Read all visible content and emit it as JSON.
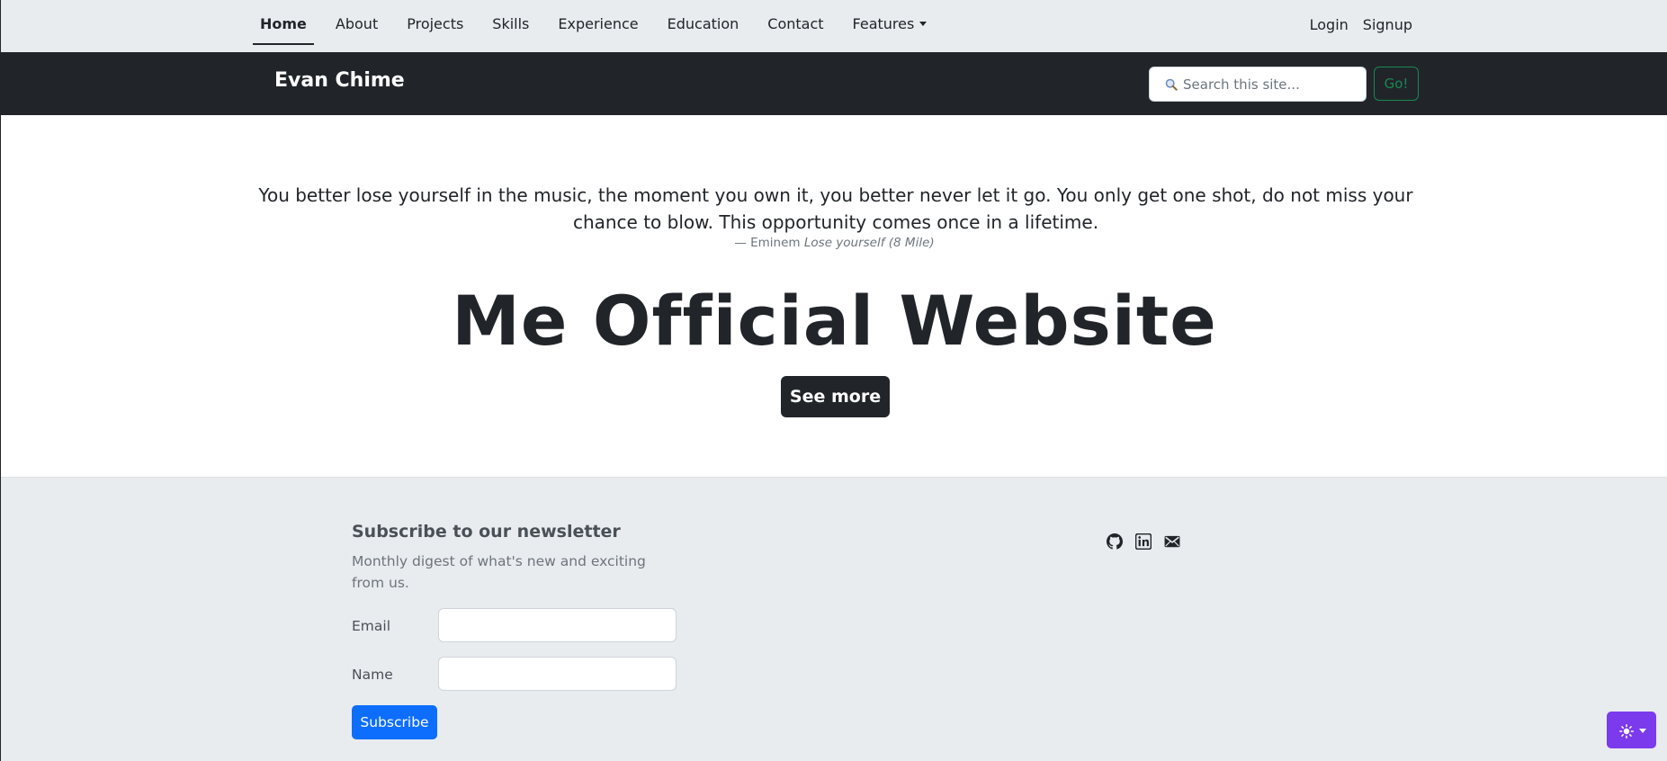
{
  "nav": {
    "items": [
      {
        "label": "Home",
        "active": true
      },
      {
        "label": "About"
      },
      {
        "label": "Projects"
      },
      {
        "label": "Skills"
      },
      {
        "label": "Experience"
      },
      {
        "label": "Education"
      },
      {
        "label": "Contact"
      },
      {
        "label": "Features",
        "dropdown": true
      }
    ],
    "login": "Login",
    "signup": "Signup"
  },
  "header": {
    "brand": "Evan Chime",
    "search_placeholder": "Search this site...",
    "search_icon": "search-icon",
    "go_label": "Go!"
  },
  "hero": {
    "quote": "You better lose yourself in the music, the moment you own it, you better never let it go. You only get one shot, do not miss your chance to blow. This opportunity comes once in a lifetime.",
    "cite_dash": "— ",
    "cite_author": "Eminem",
    "cite_work": "Lose yourself (8 Mile)",
    "title": "Me Official Website",
    "button": "See more"
  },
  "footer": {
    "newsletter_title": "Subscribe to our newsletter",
    "newsletter_desc": "Monthly digest of what's new and exciting from us.",
    "email_label": "Email",
    "name_label": "Name",
    "subscribe_label": "Subscribe",
    "social_icons": [
      "github-icon",
      "linkedin-icon",
      "mail-icon"
    ]
  },
  "theme_toggle": {
    "icon": "sun-icon"
  },
  "colors": {
    "dark": "#212529",
    "light_bg": "#e9ecef",
    "go_green": "#198754",
    "primary_blue": "#0d6efd",
    "theme_purple": "#7c3aed"
  }
}
